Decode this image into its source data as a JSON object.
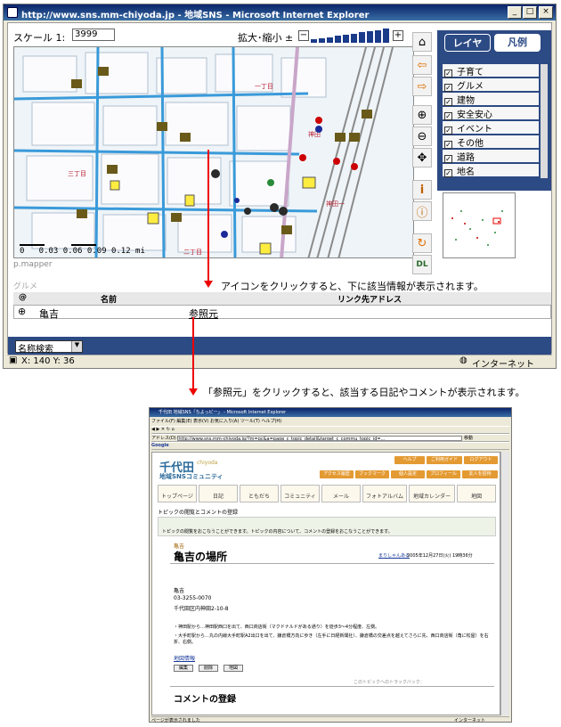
{
  "window1": {
    "title": "http://www.sns.mm-chiyoda.jp - 地域SNS - Microsoft Internet Explorer",
    "scale_label": "スケール 1:",
    "scale_value": "3999",
    "zoom_label": "拡大･縮小 ±",
    "zoom_minus": "−",
    "zoom_plus": "+",
    "tabs": [
      "レイヤ",
      "凡例"
    ],
    "layers": [
      "子育て",
      "グルメ",
      "建物",
      "安全安心",
      "イベント",
      "その他",
      "道路",
      "地名"
    ],
    "map_scale_text": "0   0.03 0.06 0.09 0.12 mi",
    "map_watermark": "p.mapper",
    "results_title": "グルメ",
    "col_at": "@",
    "col_name": "名前",
    "col_link": "リンク先アドレス",
    "row_name": "亀吉",
    "row_link": "参照元",
    "search_mode": "名称検索",
    "status_coords": "X: 140  Y: 36",
    "status_zone": "インターネット"
  },
  "annotations": {
    "a1": "アイコンをクリックすると、下に該当情報が表示されます。",
    "a2": "「参照元」をクリックすると、該当する日記やコメントが表示されます。"
  },
  "window2": {
    "title": "千代田 地域SNS「ちよっピー」 - Microsoft Internet Explorer",
    "menus": [
      "ファイル(F)",
      "編集(E)",
      "表示(V)",
      "お気に入り(A)",
      "ツール(T)",
      "ヘルプ(H)"
    ],
    "address_label": "アドレス(D)",
    "address": "http://www.sns.mm-chiyoda.jp/?m=pc&a=page_c_topic_detail&target_c_commu_topic_id=...",
    "go": "移動",
    "google": "Google",
    "site_name": "千代田",
    "site_sub": "chiyoda",
    "site_tag": "地域SNSコミュニティ",
    "user_buttons": [
      "ヘルプ",
      "ご利用ガイド",
      "ログアウト"
    ],
    "top_links": [
      "アクセス履歴",
      "ブックマーク",
      "個人設定",
      "プロフィール",
      "友人を招待"
    ],
    "nav": [
      "トップページ",
      "日記",
      "ともだち",
      "コミュニティ",
      "メール",
      "フォトアルバム",
      "地域カレンダー",
      "地図"
    ],
    "page_heading": "トピックの閲覧とコメントの登録",
    "notice": "トピックの閲覧をおこなうことができます。トピックの内容について、コメントの登録をおこなうことができます。",
    "crumb": "亀吉",
    "topic_title": "亀吉の場所",
    "topic_date": "2005年12月27日(火) 19時36分",
    "topic_author": "まりしゃんある",
    "shop_name": "亀吉",
    "shop_tel": "03-3255-0070",
    "shop_addr": "千代田区内神田2-10-8",
    "body1": "・神田駅から…神田駅西口を出て、西口商店街（マクドナルドがある通り）を徒歩3～4分程度、左側。",
    "body2": "・大手町駅から…丸の内線大手町駅A2出口を出て、鎌倉橋方向に歩き（左手に日経新聞社）、鎌倉橋の交差点を越えてさらに先、西口商店街（角に松屋）を右折、右側。",
    "map_link": "地図情報",
    "btns": [
      "編集",
      "削除",
      "地図"
    ],
    "trackback": "このトピックへのトラックバック：",
    "comment_heading": "コメントの登録",
    "status2_left": "ページが表示されました",
    "status2_right": "インターネット"
  }
}
